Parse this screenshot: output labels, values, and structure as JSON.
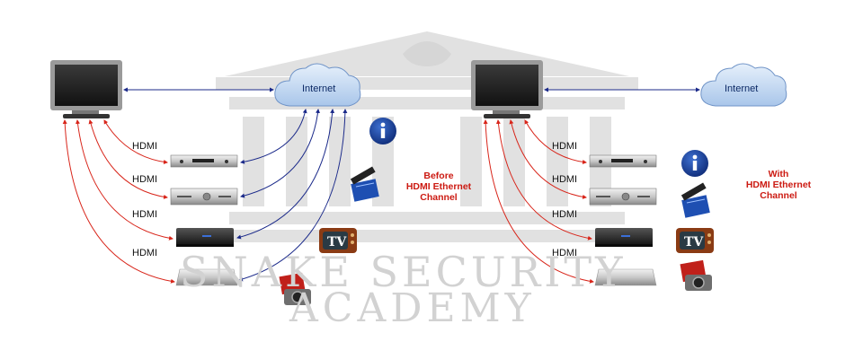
{
  "watermark": {
    "line1": "SNAKE SECURITY",
    "line2": "ACADEMY"
  },
  "left": {
    "cloud_label": "Internet",
    "caption_line1": "Before",
    "caption_line2": "HDMI Ethernet",
    "caption_line3": "Channel",
    "hdmi_labels": [
      "HDMI",
      "HDMI",
      "HDMI",
      "HDMI"
    ]
  },
  "right": {
    "cloud_label": "Internet",
    "caption_line1": "With",
    "caption_line2": "HDMI Ethernet",
    "caption_line3": "Channel",
    "hdmi_labels": [
      "HDMI",
      "HDMI",
      "HDMI",
      "HDMI"
    ]
  },
  "icons": {
    "info": "info-icon",
    "clapper": "clapperboard-icon",
    "tv": "retro-tv-icon",
    "tv_text": "TV",
    "photo": "camera-photo-icon"
  },
  "colors": {
    "hdmi_link": "#d8251a",
    "ethernet_link": "#1b2a8a",
    "caption": "#cc1a12",
    "info_blue": "#1c3f9a"
  }
}
